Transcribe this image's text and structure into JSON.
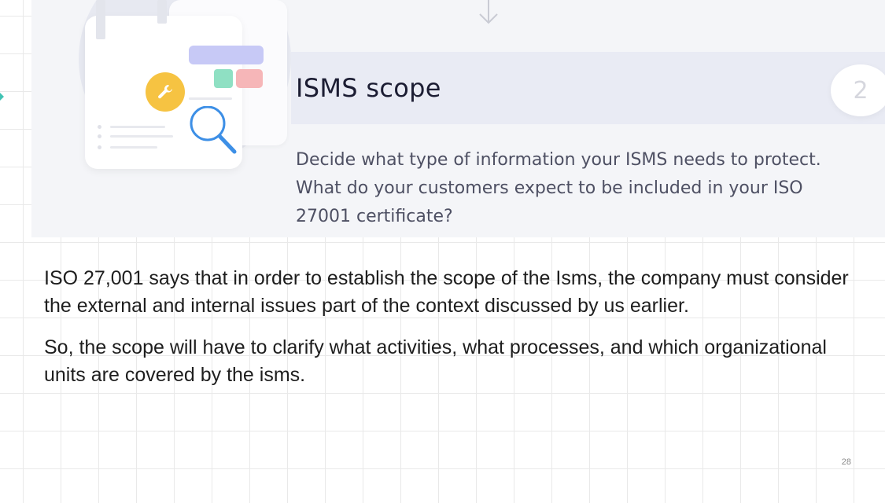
{
  "card": {
    "title": "ISMS scope",
    "number": "2",
    "description": "Decide what type of information your ISMS needs to protect. What do your customers expect to be included in your ISO 27001 certificate?"
  },
  "body": {
    "paragraph_1": "ISO 27,001 says that in order to establish the scope of the Isms, the company must consider the external and internal issues part of the context discussed by us earlier.",
    "paragraph_2": "So, the scope will have to clarify what activities, what processes, and which organizational units are covered by the isms."
  },
  "footer": {
    "page_number": "28"
  },
  "colors": {
    "accent_yellow": "#f6c342",
    "accent_blue": "#3d8fe6",
    "accent_purple": "#c7c9f6",
    "accent_green": "#8fe0c3",
    "accent_pink": "#f6b6b8",
    "title_text": "#1c1d33",
    "banner_background": "#f4f5f8"
  },
  "icons": [
    "wrench-icon",
    "magnifier-icon",
    "down-arrow-icon"
  ]
}
